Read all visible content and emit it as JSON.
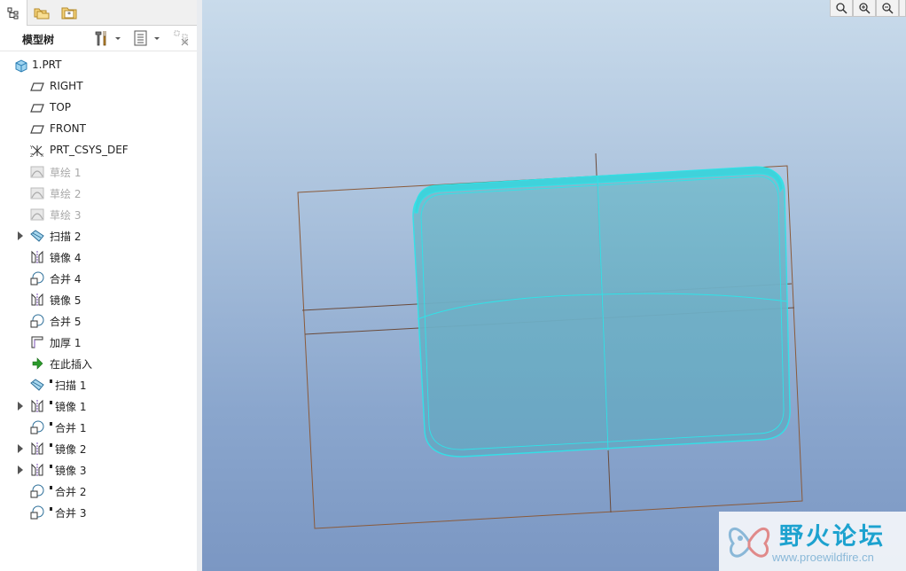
{
  "panel": {
    "title": "模型树"
  },
  "tree": [
    {
      "label": "1.PRT",
      "icon": "part-icon"
    },
    {
      "label": "RIGHT",
      "icon": "datum-plane-icon"
    },
    {
      "label": "TOP",
      "icon": "datum-plane-icon"
    },
    {
      "label": "FRONT",
      "icon": "datum-plane-icon"
    },
    {
      "label": "PRT_CSYS_DEF",
      "icon": "coordinate-system-icon"
    },
    {
      "label": "草绘 1",
      "icon": "sketch-icon",
      "dim": true
    },
    {
      "label": "草绘 2",
      "icon": "sketch-icon",
      "dim": true
    },
    {
      "label": "草绘 3",
      "icon": "sketch-icon",
      "dim": true
    },
    {
      "label": "扫描 2",
      "icon": "sweep-icon",
      "expandable": true
    },
    {
      "label": "镜像 4",
      "icon": "mirror-icon"
    },
    {
      "label": "合并 4",
      "icon": "merge-icon"
    },
    {
      "label": "镜像 5",
      "icon": "mirror-icon"
    },
    {
      "label": "合并 5",
      "icon": "merge-icon"
    },
    {
      "label": "加厚 1",
      "icon": "thicken-icon"
    },
    {
      "label": "在此插入",
      "icon": "insert-here-arrow-icon"
    },
    {
      "label": "扫描 1",
      "icon": "sweep-icon",
      "suppressed": true
    },
    {
      "label": "镜像 1",
      "icon": "mirror-icon",
      "suppressed": true,
      "expandable": true
    },
    {
      "label": "合并 1",
      "icon": "merge-icon",
      "suppressed": true
    },
    {
      "label": "镜像 2",
      "icon": "mirror-icon",
      "suppressed": true,
      "expandable": true
    },
    {
      "label": "镜像 3",
      "icon": "mirror-icon",
      "suppressed": true,
      "expandable": true
    },
    {
      "label": "合并 2",
      "icon": "merge-icon",
      "suppressed": true
    },
    {
      "label": "合并 3",
      "icon": "merge-icon",
      "suppressed": true
    }
  ],
  "watermark": {
    "name": "野火论坛",
    "url": "www.proewildfire.cn"
  },
  "colors": {
    "model_edge": "#2fe3e8",
    "model_fill": "#6fb6c8",
    "datum": "#8a5a3a",
    "watermark_text": "#1da2cf"
  }
}
